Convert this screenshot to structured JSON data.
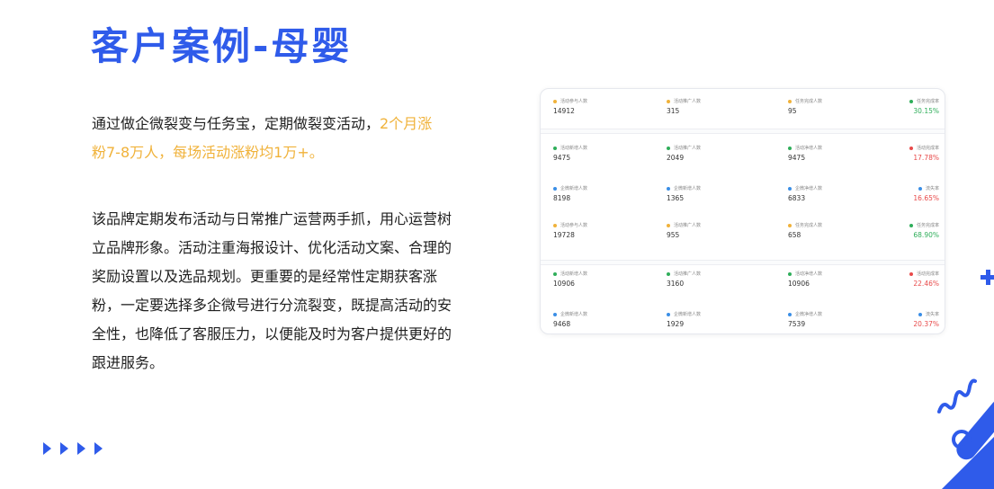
{
  "title": "客户案例-母婴",
  "para1": {
    "normal": "通过做企微裂变与任务宝，定期做裂变活动，",
    "highlight": "2个月涨粉7-8万人，每场活动涨粉均1万+。"
  },
  "para2": "该品牌定期发布活动与日常推广运营两手抓，用心运营树立品牌形象。活动注重海报设计、优化活动文案、合理的奖励设置以及选品规划。更重要的是经常性定期获客涨粉，一定要选择多企微号进行分流裂变，既提高活动的安全性，也降低了客服压力，以便能及时为客户提供更好的跟进服务。",
  "colors": {
    "accent": "#2f5bea",
    "highlight": "#f0b23a",
    "positive": "#2fae5a",
    "negative": "#e84a4a"
  },
  "dashboard": {
    "rows": [
      {
        "labels": [
          "活动参与人数",
          "活动推广人数",
          "任务完成人数",
          "任务完成率"
        ],
        "values": [
          "14912",
          "315",
          "95",
          "30.15%"
        ],
        "dots": [
          "#f0b23a",
          "#f0b23a",
          "#f0b23a",
          "#2fae5a"
        ],
        "last": "green"
      },
      {
        "labels": [
          "活动新增人数",
          "活动推广人数",
          "活动净增人数",
          "活动完成率"
        ],
        "values": [
          "9475",
          "2049",
          "9475",
          "17.78%"
        ],
        "dots": [
          "#2fae5a",
          "#2fae5a",
          "#2fae5a",
          "#e84a4a"
        ],
        "last": "red"
      },
      {
        "labels": [
          "企微新增人数",
          "企微新增人数",
          "企微净增人数",
          "流失率"
        ],
        "values": [
          "8198",
          "1365",
          "6833",
          "16.65%"
        ],
        "dots": [
          "#3a8ee6",
          "#3a8ee6",
          "#3a8ee6",
          "#3a8ee6"
        ],
        "last": "red"
      },
      {
        "labels": [
          "活动参与人数",
          "活动推广人数",
          "任务完成人数",
          "任务完成率"
        ],
        "values": [
          "19728",
          "955",
          "658",
          "68.90%"
        ],
        "dots": [
          "#f0b23a",
          "#f0b23a",
          "#f0b23a",
          "#2fae5a"
        ],
        "last": "green"
      },
      {
        "labels": [
          "活动新增人数",
          "活动推广人数",
          "活动净增人数",
          "活动完成率"
        ],
        "values": [
          "10906",
          "3160",
          "10906",
          "22.46%"
        ],
        "dots": [
          "#2fae5a",
          "#2fae5a",
          "#2fae5a",
          "#e84a4a"
        ],
        "last": "red"
      },
      {
        "labels": [
          "企微新增人数",
          "企微新增人数",
          "企微净增人数",
          "流失率"
        ],
        "values": [
          "9468",
          "1929",
          "7539",
          "20.37%"
        ],
        "dots": [
          "#3a8ee6",
          "#3a8ee6",
          "#3a8ee6",
          "#3a8ee6"
        ],
        "last": "red"
      }
    ]
  }
}
